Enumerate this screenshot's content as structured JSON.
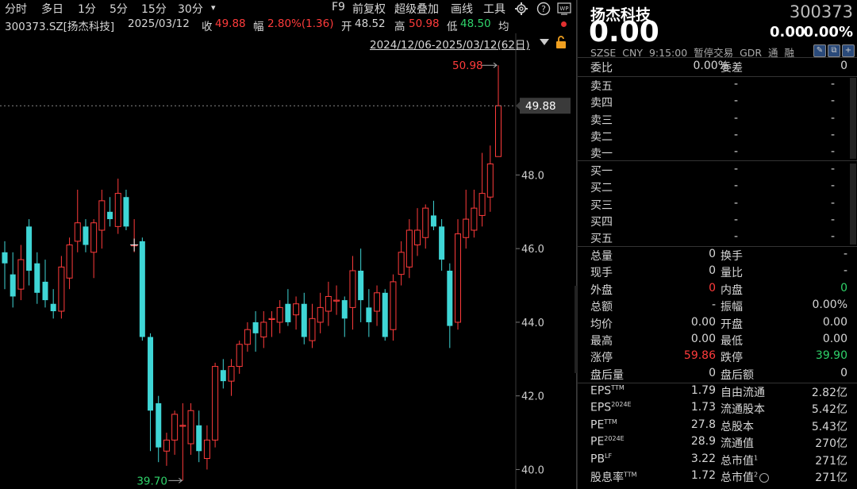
{
  "toolbar": {
    "tabs": [
      "分时",
      "多日",
      "1分",
      "5分",
      "15分",
      "30分"
    ],
    "dropdown_glyph": "▾",
    "actions": [
      "F9",
      "前复权",
      "超级叠加",
      "画线",
      "工具"
    ]
  },
  "info": {
    "code": "300373.SZ[扬杰科技]",
    "date": "2025/03/12",
    "close_label": "收",
    "close": "49.88",
    "change_label": "幅",
    "change": "2.80%(1.36)",
    "open_label": "开",
    "open": "48.52",
    "high_label": "高",
    "high": "50.98",
    "low_label": "低",
    "low": "48.50",
    "avg_label": "均",
    "range": "2024/12/06-2025/03/12(62日)"
  },
  "chart_data": {
    "type": "candlestick",
    "y_ticks": [
      "48.0",
      "46.0",
      "44.0",
      "42.0",
      "40.0"
    ],
    "ylim": [
      39.6,
      51.2
    ],
    "current_price_tag": "49.88",
    "high_annotation": "50.98",
    "low_annotation": "39.70",
    "candles": [
      {
        "o": 45.9,
        "c": 45.6,
        "h": 46.2,
        "l": 44.9
      },
      {
        "o": 45.3,
        "c": 44.7,
        "h": 45.9,
        "l": 44.4
      },
      {
        "o": 44.9,
        "c": 45.7,
        "h": 46.1,
        "l": 44.6
      },
      {
        "o": 46.6,
        "c": 45.4,
        "h": 46.8,
        "l": 45.0
      },
      {
        "o": 45.6,
        "c": 44.8,
        "h": 45.9,
        "l": 44.5
      },
      {
        "o": 45.1,
        "c": 44.6,
        "h": 45.7,
        "l": 44.4
      },
      {
        "o": 44.5,
        "c": 44.3,
        "h": 44.9,
        "l": 44.1
      },
      {
        "o": 44.3,
        "c": 45.5,
        "h": 45.8,
        "l": 44.1
      },
      {
        "o": 45.2,
        "c": 46.1,
        "h": 46.3,
        "l": 44.9
      },
      {
        "o": 46.2,
        "c": 46.7,
        "h": 47.6,
        "l": 45.9
      },
      {
        "o": 46.6,
        "c": 46.1,
        "h": 46.8,
        "l": 45.9
      },
      {
        "o": 45.9,
        "c": 46.7,
        "h": 46.8,
        "l": 45.2
      },
      {
        "o": 46.5,
        "c": 47.3,
        "h": 47.6,
        "l": 46.0
      },
      {
        "o": 47.0,
        "c": 46.8,
        "h": 47.4,
        "l": 46.6
      },
      {
        "o": 46.6,
        "c": 47.5,
        "h": 47.9,
        "l": 46.4
      },
      {
        "o": 47.4,
        "c": 46.6,
        "h": 47.6,
        "l": 46.5
      },
      {
        "o": 46.1,
        "c": 46.1,
        "h": 46.8,
        "l": 45.9
      },
      {
        "o": 46.2,
        "c": 43.6,
        "h": 46.3,
        "l": 43.5
      },
      {
        "o": 43.6,
        "c": 41.6,
        "h": 43.7,
        "l": 40.5
      },
      {
        "o": 41.8,
        "c": 40.6,
        "h": 42.0,
        "l": 40.2
      },
      {
        "o": 40.5,
        "c": 40.8,
        "h": 41.0,
        "l": 40.1
      },
      {
        "o": 40.8,
        "c": 41.5,
        "h": 41.6,
        "l": 40.4
      },
      {
        "o": 41.2,
        "c": 41.2,
        "h": 41.8,
        "l": 39.7
      },
      {
        "o": 40.7,
        "c": 41.6,
        "h": 41.8,
        "l": 40.4
      },
      {
        "o": 41.2,
        "c": 40.5,
        "h": 41.6,
        "l": 40.2
      },
      {
        "o": 40.3,
        "c": 40.8,
        "h": 41.2,
        "l": 40.0
      },
      {
        "o": 40.8,
        "c": 42.8,
        "h": 42.9,
        "l": 40.6
      },
      {
        "o": 42.7,
        "c": 42.4,
        "h": 43.0,
        "l": 42.2
      },
      {
        "o": 42.4,
        "c": 42.8,
        "h": 43.0,
        "l": 42.0
      },
      {
        "o": 42.8,
        "c": 43.4,
        "h": 43.5,
        "l": 42.6
      },
      {
        "o": 43.4,
        "c": 43.8,
        "h": 44.0,
        "l": 43.2
      },
      {
        "o": 44.0,
        "c": 43.7,
        "h": 44.3,
        "l": 43.2
      },
      {
        "o": 43.6,
        "c": 44.0,
        "h": 44.3,
        "l": 43.3
      },
      {
        "o": 44.1,
        "c": 44.1,
        "h": 44.3,
        "l": 43.6
      },
      {
        "o": 44.0,
        "c": 44.4,
        "h": 44.6,
        "l": 43.7
      },
      {
        "o": 44.5,
        "c": 44.0,
        "h": 44.9,
        "l": 43.9
      },
      {
        "o": 44.2,
        "c": 44.5,
        "h": 44.7,
        "l": 43.8
      },
      {
        "o": 44.5,
        "c": 43.6,
        "h": 44.8,
        "l": 43.4
      },
      {
        "o": 43.5,
        "c": 44.1,
        "h": 44.5,
        "l": 43.3
      },
      {
        "o": 44.0,
        "c": 44.4,
        "h": 44.8,
        "l": 43.7
      },
      {
        "o": 44.3,
        "c": 44.7,
        "h": 45.1,
        "l": 43.9
      },
      {
        "o": 44.6,
        "c": 44.6,
        "h": 45.0,
        "l": 44.2
      },
      {
        "o": 44.6,
        "c": 44.1,
        "h": 44.7,
        "l": 43.6
      },
      {
        "o": 44.4,
        "c": 45.4,
        "h": 45.8,
        "l": 43.8
      },
      {
        "o": 45.4,
        "c": 44.6,
        "h": 46.0,
        "l": 44.0
      },
      {
        "o": 44.4,
        "c": 44.0,
        "h": 44.9,
        "l": 43.6
      },
      {
        "o": 44.3,
        "c": 44.8,
        "h": 45.0,
        "l": 43.9
      },
      {
        "o": 44.8,
        "c": 43.6,
        "h": 44.9,
        "l": 43.5
      },
      {
        "o": 43.8,
        "c": 45.1,
        "h": 45.3,
        "l": 43.5
      },
      {
        "o": 45.3,
        "c": 45.9,
        "h": 46.2,
        "l": 45.0
      },
      {
        "o": 45.5,
        "c": 46.5,
        "h": 46.8,
        "l": 45.2
      },
      {
        "o": 46.1,
        "c": 46.5,
        "h": 47.1,
        "l": 45.8
      },
      {
        "o": 46.3,
        "c": 47.1,
        "h": 47.2,
        "l": 46.0
      },
      {
        "o": 46.9,
        "c": 46.6,
        "h": 47.3,
        "l": 46.5
      },
      {
        "o": 46.6,
        "c": 45.7,
        "h": 46.8,
        "l": 45.4
      },
      {
        "o": 45.4,
        "c": 43.9,
        "h": 45.6,
        "l": 43.3
      },
      {
        "o": 44.0,
        "c": 46.4,
        "h": 46.8,
        "l": 43.8
      },
      {
        "o": 46.3,
        "c": 46.8,
        "h": 47.6,
        "l": 46.0
      },
      {
        "o": 46.5,
        "c": 47.1,
        "h": 47.6,
        "l": 46.3
      },
      {
        "o": 46.9,
        "c": 47.5,
        "h": 48.6,
        "l": 46.6
      },
      {
        "o": 47.4,
        "c": 48.3,
        "h": 48.8,
        "l": 47.0
      },
      {
        "o": 48.5,
        "c": 49.88,
        "h": 50.98,
        "l": 48.5
      }
    ]
  },
  "quote": {
    "name": "扬杰科技",
    "code": "300373",
    "price": "0.00",
    "change": "0.00",
    "change_pct": "0.00%",
    "meta": [
      "SZSE",
      "CNY",
      "9:15:00",
      "暂停交易",
      "GDR",
      "通",
      "融"
    ],
    "ratio_label": "委比",
    "ratio_value": "0.00%",
    "diff_label": "委差",
    "diff_value": "0",
    "asks": [
      {
        "label": "卖五",
        "price": "-",
        "vol": "-"
      },
      {
        "label": "卖四",
        "price": "-",
        "vol": "-"
      },
      {
        "label": "卖三",
        "price": "-",
        "vol": "-"
      },
      {
        "label": "卖二",
        "price": "-",
        "vol": "-"
      },
      {
        "label": "卖一",
        "price": "-",
        "vol": "-"
      }
    ],
    "bids": [
      {
        "label": "买一",
        "price": "-",
        "vol": "-"
      },
      {
        "label": "买二",
        "price": "-",
        "vol": "-"
      },
      {
        "label": "买三",
        "price": "-",
        "vol": "-"
      },
      {
        "label": "买四",
        "price": "-",
        "vol": "-"
      },
      {
        "label": "买五",
        "price": "-",
        "vol": "-"
      }
    ],
    "stats": [
      {
        "l1": "总量",
        "v1": "0",
        "l2": "换手",
        "v2": "-"
      },
      {
        "l1": "现手",
        "v1": "0",
        "l2": "量比",
        "v2": "-"
      },
      {
        "l1": "外盘",
        "v1": "0",
        "l2": "内盘",
        "v2": "0"
      },
      {
        "l1": "总额",
        "v1": "-",
        "l2": "振幅",
        "v2": "0.00%"
      },
      {
        "l1": "均价",
        "v1": "0.00",
        "l2": "开盘",
        "v2": "0.00"
      },
      {
        "l1": "最高",
        "v1": "0.00",
        "l2": "最低",
        "v2": "0.00"
      },
      {
        "l1": "涨停",
        "v1": "59.86",
        "l2": "跌停",
        "v2": "39.90"
      },
      {
        "l1": "盘后量",
        "v1": "0",
        "l2": "盘后额",
        "v2": "0"
      }
    ],
    "fundamentals": [
      {
        "l1": "EPS",
        "s1": "TTM",
        "v1": "1.79",
        "l2": "自由流通",
        "s2": "",
        "v2": "2.82亿"
      },
      {
        "l1": "EPS",
        "s1": "2024E",
        "v1": "1.73",
        "l2": "流通股本",
        "s2": "",
        "v2": "5.42亿"
      },
      {
        "l1": "PE",
        "s1": "TTM",
        "v1": "27.8",
        "l2": "总股本",
        "s2": "",
        "v2": "5.43亿"
      },
      {
        "l1": "PE",
        "s1": "2024E",
        "v1": "28.9",
        "l2": "流通值",
        "s2": "",
        "v2": "270亿"
      },
      {
        "l1": "PB",
        "s1": "LF",
        "v1": "3.22",
        "l2": "总市值",
        "s2": "1",
        "v2": "271亿"
      },
      {
        "l1": "股息率",
        "s1": "TTM",
        "v1": "1.72",
        "l2": "总市值",
        "s2": "2",
        "v2": "271亿"
      }
    ]
  },
  "colors": {
    "up": "#ff3b3b",
    "down": "#3fd6d6",
    "green": "#2fd36a",
    "bg": "#000000",
    "text": "#d6d6d6"
  }
}
